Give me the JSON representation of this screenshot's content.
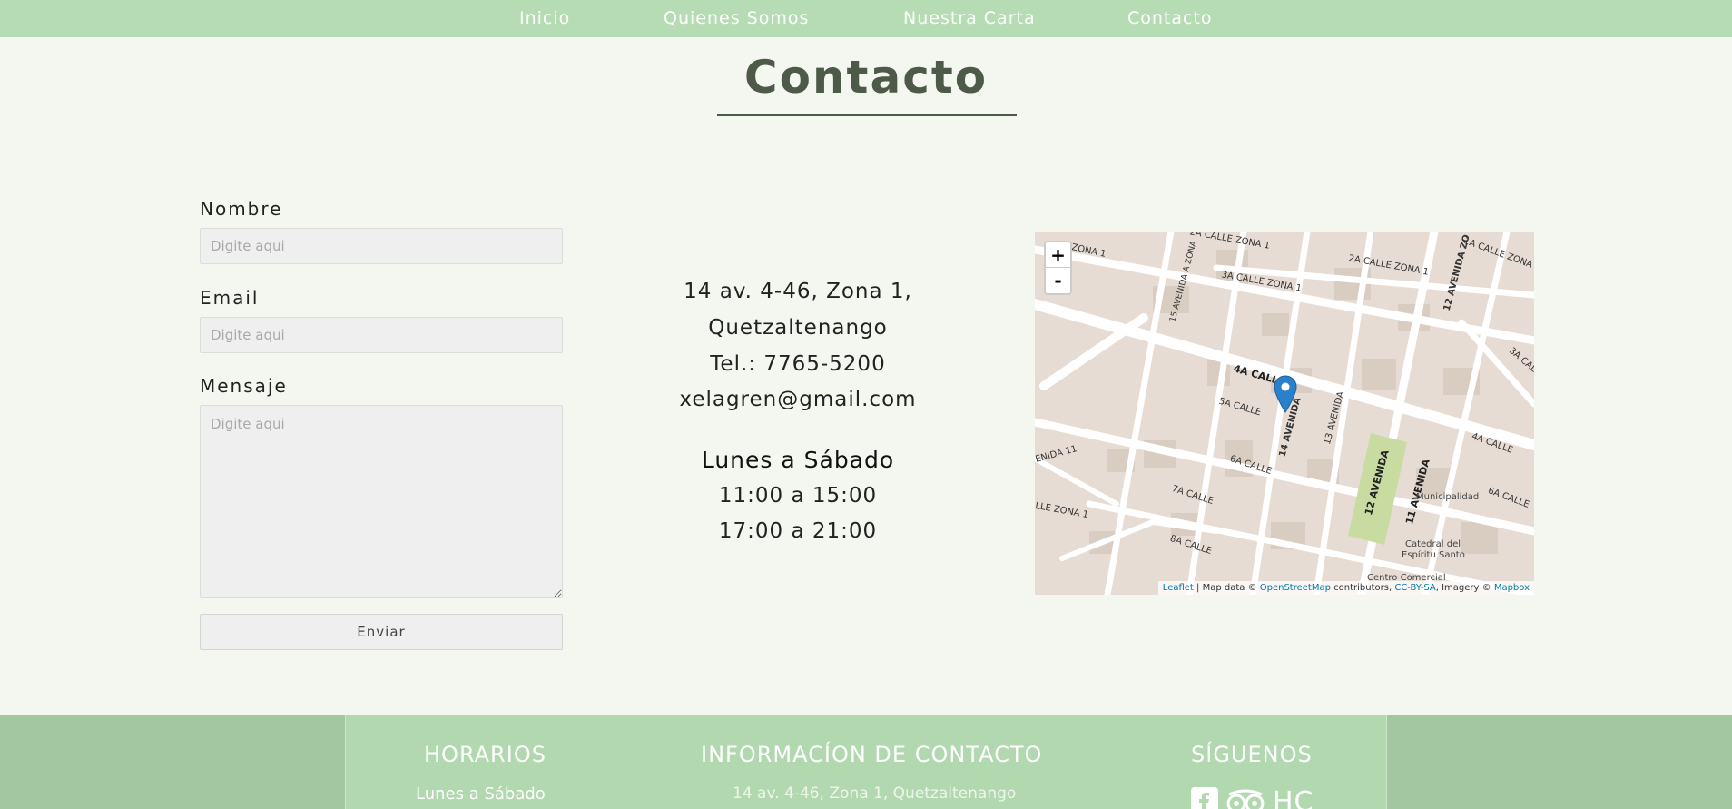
{
  "nav": {
    "items": [
      "Inicio",
      "Quienes Somos",
      "Nuestra Carta",
      "Contacto"
    ]
  },
  "page": {
    "title": "Contacto"
  },
  "form": {
    "name_label": "Nombre",
    "name_placeholder": "Digite aqui",
    "email_label": "Email",
    "email_placeholder": "Digite aqui",
    "message_label": "Mensaje",
    "message_placeholder": "Digite aqui",
    "submit_label": "Enviar"
  },
  "info": {
    "address_line1": "14 av. 4-46, Zona 1,",
    "address_line2": "Quetzaltenango",
    "phone": "Tel.: 7765-5200",
    "email": "xelagren@gmail.com",
    "days": "Lunes a Sábado",
    "hours1": "11:00 a 15:00",
    "hours2": "17:00 a 21:00"
  },
  "map": {
    "zoom_in": "+",
    "zoom_out": "-",
    "attribution": {
      "leaflet": "Leaflet",
      "text1": " | Map data © ",
      "osm": "OpenStreetMap",
      "text2": " contributors, ",
      "license": "CC-BY-SA",
      "text3": ", Imagery © ",
      "mapbox": "Mapbox"
    },
    "street_labels": [
      "2A CALLE ZONA 1",
      "2A CALLE ZONA 1",
      "1A CALLE ZONA 1",
      "ZONA 1",
      "15 AVENIDA A ZONA",
      "12 AVENIDA ZO",
      "3A CALLE ZONA 1",
      "3A CALLE",
      "4A CALLE",
      "5A CALLE",
      "14 AVENIDA",
      "13 AVENIDA",
      "4A CALLE",
      "6A CALLE",
      "6A CALLE",
      "12 AVENIDA",
      "11 AVENIDA",
      "7A CALLE",
      "8A CALLE",
      "LLE ZONA 1",
      "ENIDA 11",
      "Municipalidad",
      "Catedral del",
      "Espíritu Santo",
      "Centro Comercial"
    ],
    "accent_color": "#2a81cb"
  },
  "footer": {
    "hours_title": "HORARIOS",
    "hours_days": "Lunes a Sábado",
    "contact_title": "INFORMACÍON DE CONTACTO",
    "contact_address": "14 av. 4-46, Zona 1, Quetzaltenango",
    "social_title": "SÍGUENOS",
    "social_icons": [
      "facebook-icon",
      "tripadvisor-icon",
      "hc-logo"
    ],
    "social_text": "HC"
  },
  "colors": {
    "nav_bg": "#b6dcb4",
    "page_bg": "#f4f7ef",
    "footer_side": "#a3c7a1",
    "footer_mid": "#b2d8b0",
    "title_color": "#4e5a48"
  }
}
